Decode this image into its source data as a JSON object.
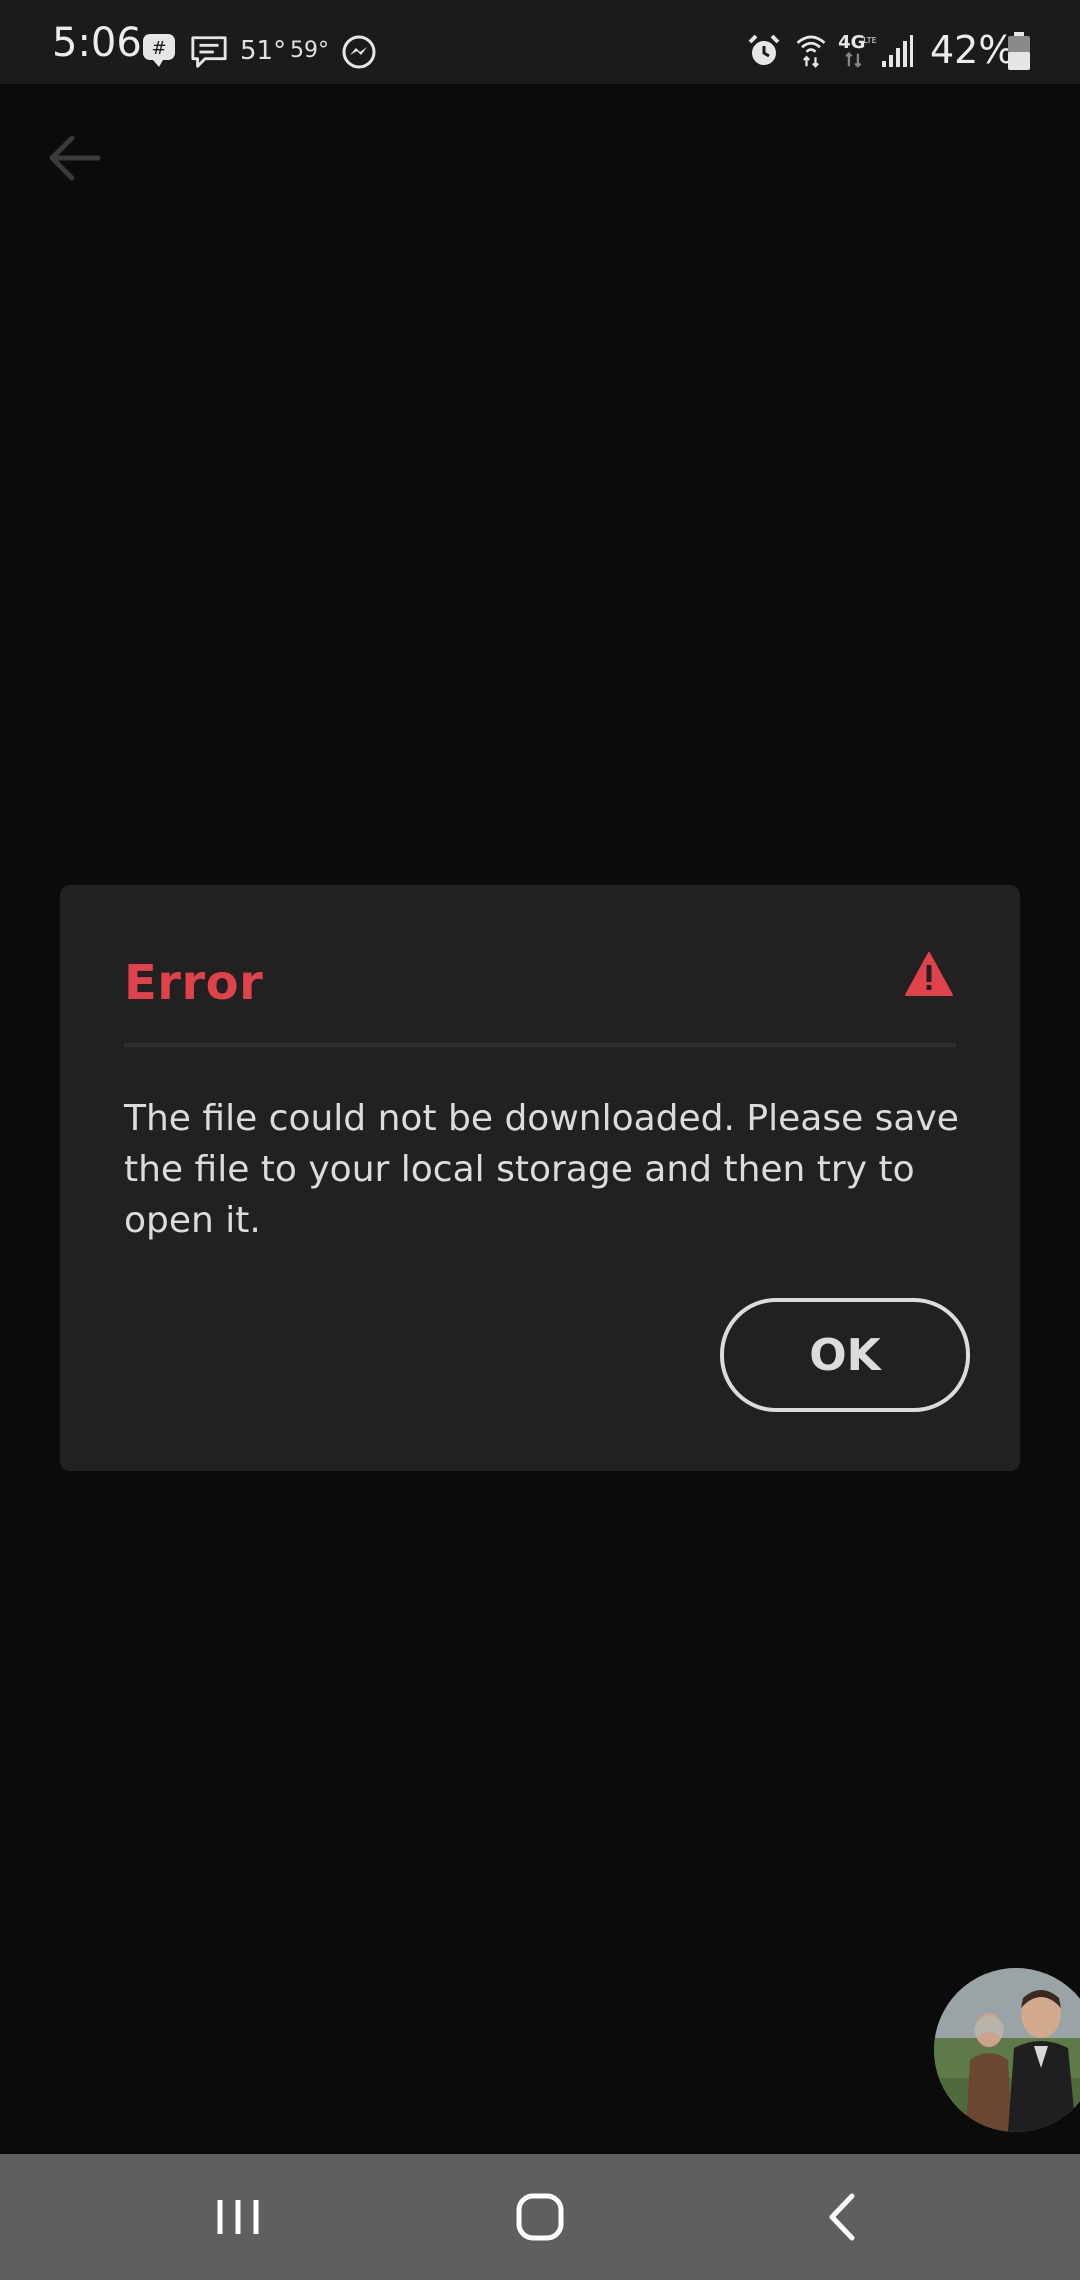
{
  "status_bar": {
    "time": "5:06",
    "temp_1": "51°",
    "temp_2": "59°",
    "battery_percent": "42%",
    "icons": [
      "chat-bubble-icon",
      "message-icon",
      "messenger-icon",
      "alarm-icon",
      "wifi-icon",
      "4g-lte-icon",
      "signal-icon",
      "battery-icon"
    ]
  },
  "toolbar": {
    "back_icon": "back-arrow-icon"
  },
  "dialog": {
    "title": "Error",
    "title_color": "#e0424b",
    "icon": "warning-icon",
    "message": "The file could not be downloaded. Please save the file to your local storage and then try to open it.",
    "ok_label": "OK"
  },
  "chat_head": {
    "icon": "avatar"
  },
  "nav_bar": {
    "items": [
      "recent-apps-icon",
      "home-icon",
      "back-icon"
    ]
  }
}
